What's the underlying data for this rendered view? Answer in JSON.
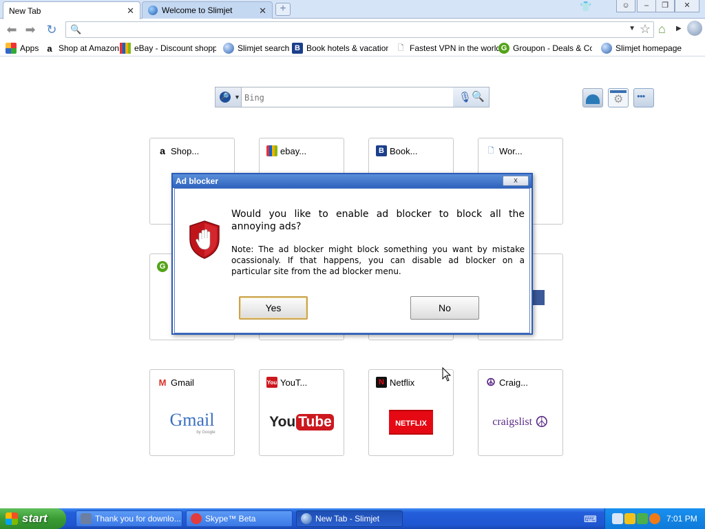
{
  "browser": {
    "tabs": [
      {
        "title": "New Tab",
        "active": true
      },
      {
        "title": "Welcome to Slimjet",
        "active": false
      }
    ],
    "address_value": "",
    "bookmarks": [
      {
        "label": "Apps",
        "icon": "apps-grid-icon"
      },
      {
        "label": "Shop at Amazon",
        "icon": "amazon-icon"
      },
      {
        "label": "eBay - Discount shoppin",
        "icon": "ebay-icon"
      },
      {
        "label": "Slimjet search",
        "icon": "globe-icon"
      },
      {
        "label": "Book hotels & vacation r",
        "icon": "booking-icon"
      },
      {
        "label": "Fastest VPN in the world",
        "icon": "page-icon"
      },
      {
        "label": "Groupon - Deals & Coup",
        "icon": "groupon-icon"
      },
      {
        "label": "Slimjet homepage",
        "icon": "globe-icon"
      }
    ]
  },
  "newtab": {
    "search_placeholder": "Bing",
    "tiles": [
      {
        "label": "Shop...",
        "icon": "amazon-icon"
      },
      {
        "label": "ebay...",
        "icon": "ebay-icon"
      },
      {
        "label": "Book...",
        "icon": "booking-icon"
      },
      {
        "label": "Wor...",
        "icon": "page-icon"
      },
      {
        "label": "",
        "icon": "groupon-icon"
      },
      {
        "label": "Gmail",
        "icon": "gmail-icon",
        "logo": "Gmail",
        "sublogo": "by Google"
      },
      {
        "label": "YouT...",
        "icon": "youtube-icon",
        "logo_left": "You",
        "logo_right": "Tube"
      },
      {
        "label": "Netflix",
        "icon": "netflix-icon",
        "logo": "NETFLIX"
      },
      {
        "label": "Craig...",
        "icon": "peace-icon",
        "logo": "craigslist"
      }
    ]
  },
  "dialog": {
    "title": "Ad blocker",
    "close_label": "x",
    "question": "Would you like to enable ad blocker to block all the annoying ads?",
    "note": "Note: The ad blocker might block something you want by mistake ocassionaly. If that happens, you can disable ad blocker on a particular site from the ad blocker menu.",
    "yes_label": "Yes",
    "no_label": "No"
  },
  "taskbar": {
    "start_label": "start",
    "items": [
      {
        "label": "Thank you for downlo...",
        "active": false
      },
      {
        "label": "Skype™ Beta",
        "active": false
      },
      {
        "label": "New Tab - Slimjet",
        "active": true
      }
    ],
    "clock": "7:01 PM"
  },
  "colors": {
    "dialog_title": "#2d63bd",
    "taskbar": "#245edb",
    "start": "#3a9c35"
  }
}
